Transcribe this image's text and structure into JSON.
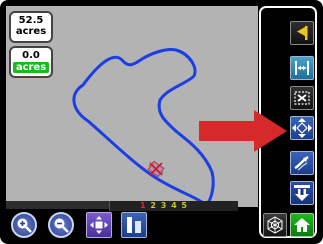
{
  "map": {
    "area_total": {
      "value": "52.5",
      "unit": "acres"
    },
    "area_applied": {
      "value": "0.0",
      "unit": "acres"
    },
    "boundary_color": "#1c3ee6",
    "vehicle_icon": "vehicle-marker-icon",
    "background_color": "#b3b3b3"
  },
  "status_bar": {
    "sections_active": "1",
    "sections_inactive": "2 3 4 5",
    "active_color": "#d52a2a",
    "inactive_color": "#c8c81e"
  },
  "bottom_toolbar": {
    "items": [
      {
        "name": "zoom-in-button",
        "icon": "zoom-in-icon"
      },
      {
        "name": "zoom-out-button",
        "icon": "zoom-out-icon"
      },
      {
        "name": "pan-view-button",
        "icon": "pan-arrows-icon"
      },
      {
        "name": "view-mode-button",
        "icon": "split-view-icon"
      }
    ]
  },
  "side_toolbar": {
    "items": [
      {
        "name": "mark-point-button",
        "icon": "flag-icon"
      },
      {
        "name": "implement-width-button",
        "icon": "width-arrows-icon"
      },
      {
        "name": "clear-button",
        "icon": "clear-selection-icon"
      },
      {
        "name": "pan-button",
        "icon": "pan-arrows-icon"
      },
      {
        "name": "nudge-button",
        "icon": "nudge-icon"
      },
      {
        "name": "headland-button",
        "icon": "headland-icon"
      },
      {
        "name": "setup-button",
        "icon": "spiderweb-icon"
      },
      {
        "name": "home-button",
        "icon": "home-icon"
      }
    ]
  },
  "callout_arrow": {
    "color": "#d62a2a",
    "target": "pan-button"
  }
}
